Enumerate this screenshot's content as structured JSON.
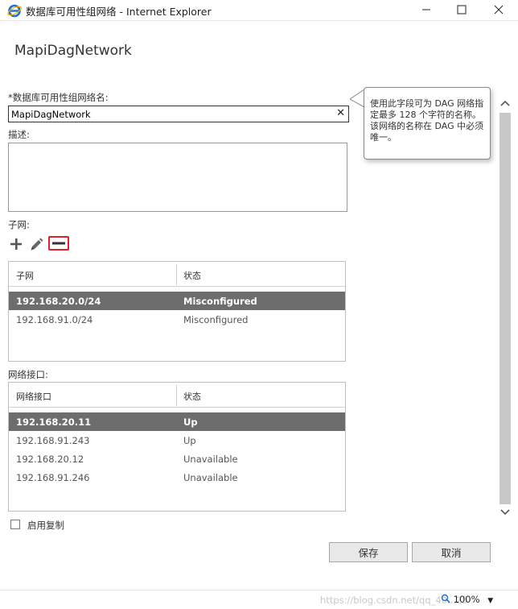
{
  "window": {
    "title": "数据库可用性组网络 - Internet Explorer",
    "icons": {
      "app": "internet-explorer-icon",
      "minimize": "minimize-icon",
      "maximize": "maximize-icon",
      "close": "close-icon"
    }
  },
  "page": {
    "title": "MapiDagNetwork",
    "name_label": "*数据库可用性组网络名:",
    "name_value": "MapiDagNetwork",
    "description_label": "描述:",
    "description_value": "",
    "tooltip": "使用此字段可为 DAG 网络指定最多 128 个字符的名称。该网络的名称在 DAG 中必须唯一。",
    "subnets_label": "子网:",
    "toolbar": {
      "add": "plus-icon",
      "edit": "pencil-icon",
      "remove": "minus-icon"
    },
    "subnets_table": {
      "columns": [
        "子网",
        "状态"
      ],
      "rows": [
        {
          "subnet": "192.168.20.0/24",
          "status": "Misconfigured",
          "selected": true
        },
        {
          "subnet": "192.168.91.0/24",
          "status": "Misconfigured",
          "selected": false
        }
      ]
    },
    "interfaces_label": "网络接口:",
    "interfaces_table": {
      "columns": [
        "网络接口",
        "状态"
      ],
      "rows": [
        {
          "interface": "192.168.20.11",
          "status": "Up",
          "selected": true
        },
        {
          "interface": "192.168.91.243",
          "status": "Up",
          "selected": false
        },
        {
          "interface": "192.168.20.12",
          "status": "Unavailable",
          "selected": false
        },
        {
          "interface": "192.168.91.246",
          "status": "Unavailable",
          "selected": false
        }
      ]
    },
    "replication_label": "启用复制",
    "replication_checked": false,
    "save_label": "保存",
    "cancel_label": "取消"
  },
  "statusbar": {
    "watermark": "https://blog.csdn.net/qq_40...25",
    "zoom": "100%"
  },
  "colors": {
    "selected_row": "#6d6d6d",
    "remove_highlight": "#e0202a",
    "ie_blue": "#1e6fd0"
  }
}
